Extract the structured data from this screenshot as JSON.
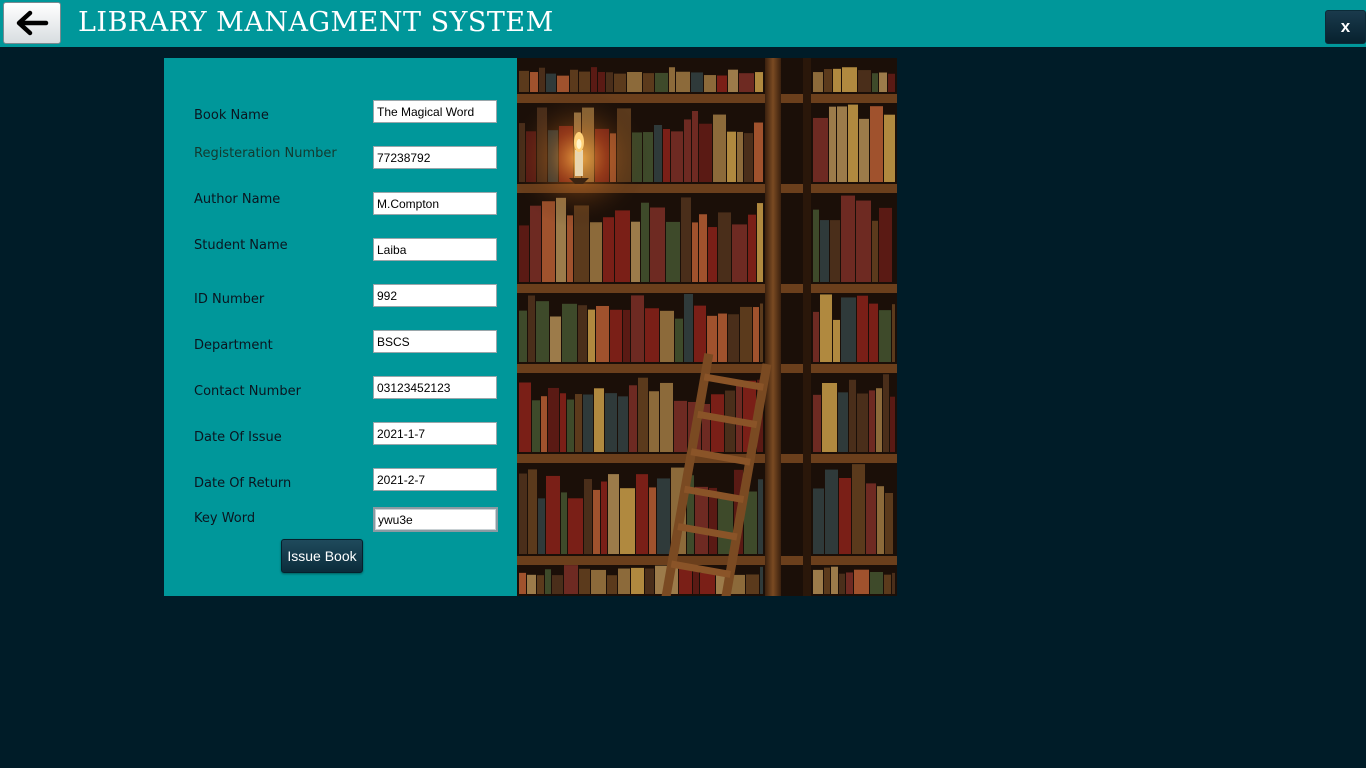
{
  "header": {
    "title": "LIBRARY MANAGMENT SYSTEM",
    "back_icon": "arrow-left-icon",
    "close_label": "x"
  },
  "form": {
    "fields": [
      {
        "label": "Book Name",
        "value": "The Magical Word"
      },
      {
        "label": "Registeration Number",
        "value": "77238792"
      },
      {
        "label": "Author Name",
        "value": "M.Compton"
      },
      {
        "label": "Student Name",
        "value": "Laiba"
      },
      {
        "label": "ID Number",
        "value": "992"
      },
      {
        "label": "Department",
        "value": "BSCS"
      },
      {
        "label": "Contact Number",
        "value": "03123452123"
      },
      {
        "label": "Date Of Issue",
        "value": "2021-1-7"
      },
      {
        "label": "Date Of Return",
        "value": "2021-2-7"
      },
      {
        "label": "Key Word",
        "value": "ywu3e"
      }
    ],
    "submit_label": "Issue Book"
  },
  "colors": {
    "accent": "#00979a",
    "background": "#001c28",
    "button_dark": "#0b2c3b"
  }
}
